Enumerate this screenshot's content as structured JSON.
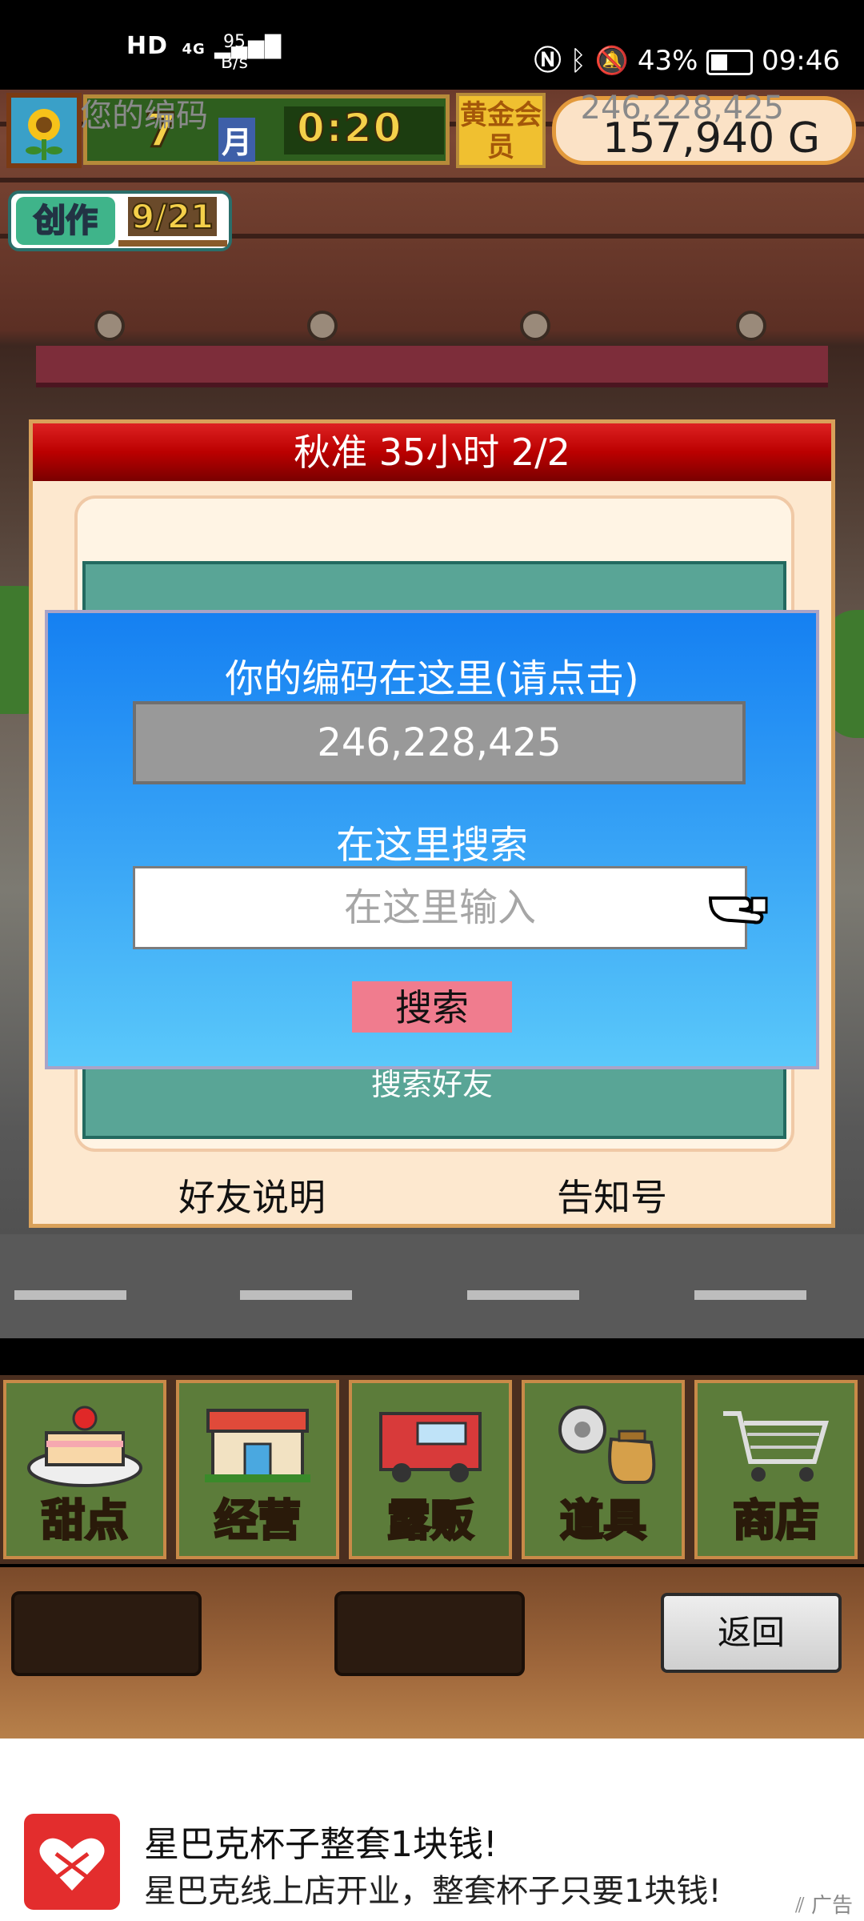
{
  "status_bar": {
    "network_left": "HD",
    "network_gen": "4G",
    "speed_value": "95",
    "speed_unit": "B/s",
    "battery": "43%",
    "time": "09:46"
  },
  "hud": {
    "month_number": "7",
    "month_word": "月",
    "clock": "0:20",
    "gold_member": "黄金会员",
    "money": "157,940 G",
    "craft_label": "创作",
    "craft_count": "9/21"
  },
  "panel": {
    "title": "秋准  35小时 2/2",
    "code_label": "您的编码",
    "code_value": "246,228,425",
    "search_friend": "搜索好友",
    "footer_left": "好友说明",
    "footer_right": "告知号"
  },
  "dialog": {
    "title": "你的编码在这里(请点击)",
    "code_button": "246,228,425",
    "search_label": "在这里搜索",
    "input_placeholder": "在这里输入",
    "search_button": "搜索"
  },
  "menu": {
    "items": [
      {
        "label": "甜点",
        "icon": "cake-icon"
      },
      {
        "label": "经营",
        "icon": "shop-building-icon"
      },
      {
        "label": "露贩",
        "icon": "food-truck-icon"
      },
      {
        "label": "道具",
        "icon": "gear-sack-icon"
      },
      {
        "label": "商店",
        "icon": "shopping-cart-icon"
      }
    ]
  },
  "bottom": {
    "back_button": "返回"
  },
  "ad": {
    "title": "星巴克杯子整套1块钱!",
    "subtitle": "星巴克线上店开业，整套杯子只要1块钱!",
    "badge": "广告"
  }
}
